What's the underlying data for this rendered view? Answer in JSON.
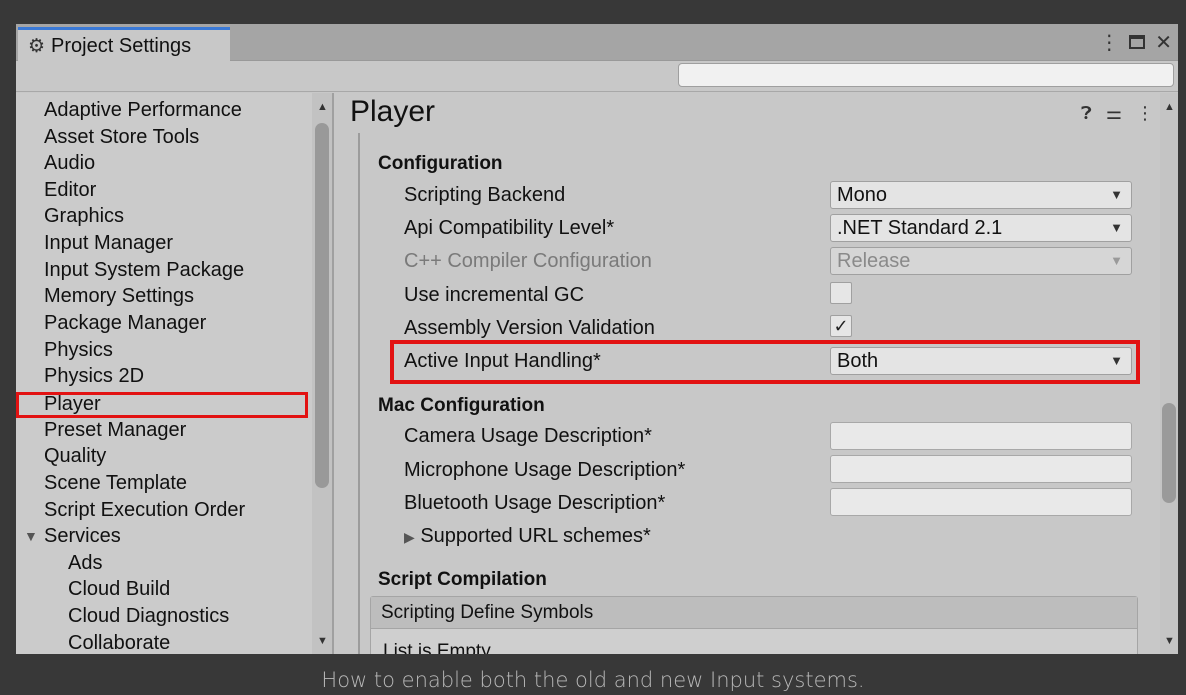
{
  "window": {
    "tab_title": "Project Settings",
    "controls": {
      "menu": "⋮",
      "maximize": "□",
      "close": "✕"
    }
  },
  "search": {
    "value": "",
    "placeholder": ""
  },
  "sidebar": {
    "items": [
      {
        "label": "Adaptive Performance"
      },
      {
        "label": "Asset Store Tools"
      },
      {
        "label": "Audio"
      },
      {
        "label": "Editor"
      },
      {
        "label": "Graphics"
      },
      {
        "label": "Input Manager"
      },
      {
        "label": "Input System Package"
      },
      {
        "label": "Memory Settings"
      },
      {
        "label": "Package Manager"
      },
      {
        "label": "Physics"
      },
      {
        "label": "Physics 2D"
      },
      {
        "label": "Player",
        "selected": true
      },
      {
        "label": "Preset Manager"
      },
      {
        "label": "Quality"
      },
      {
        "label": "Scene Template"
      },
      {
        "label": "Script Execution Order"
      },
      {
        "label": "Services",
        "expanded": true
      },
      {
        "label": "Ads"
      },
      {
        "label": "Cloud Build"
      },
      {
        "label": "Cloud Diagnostics"
      },
      {
        "label": "Collaborate"
      }
    ]
  },
  "main": {
    "title": "Player",
    "header_icons": [
      "help-icon",
      "sliders-icon",
      "more-icon"
    ],
    "configuration": {
      "heading": "Configuration",
      "scripting_backend": {
        "label": "Scripting Backend",
        "value": "Mono"
      },
      "api_level": {
        "label": "Api Compatibility Level*",
        "value": ".NET Standard 2.1"
      },
      "cpp_compiler": {
        "label": "C++ Compiler Configuration",
        "value": "Release"
      },
      "incremental_gc": {
        "label": "Use incremental GC",
        "checked": false
      },
      "assembly_validation": {
        "label": "Assembly Version Validation",
        "checked": true,
        "mark": "✓"
      },
      "active_input": {
        "label": "Active Input Handling*",
        "value": "Both"
      }
    },
    "mac_configuration": {
      "heading": "Mac Configuration",
      "camera": {
        "label": "Camera Usage Description*",
        "value": ""
      },
      "microphone": {
        "label": "Microphone Usage Description*",
        "value": ""
      },
      "bluetooth": {
        "label": "Bluetooth Usage Description*",
        "value": ""
      },
      "url_schemes": {
        "label": "Supported URL schemes*"
      }
    },
    "script_compilation": {
      "heading": "Script Compilation",
      "define_symbols": {
        "header": "Scripting Define Symbols",
        "empty": "List is Empty"
      }
    }
  },
  "caption": "How to enable both the old and new Input systems.",
  "colors": {
    "highlight": "#e21212",
    "tab_accent": "#3a79d6",
    "panel_bg": "#c8c8c8"
  }
}
